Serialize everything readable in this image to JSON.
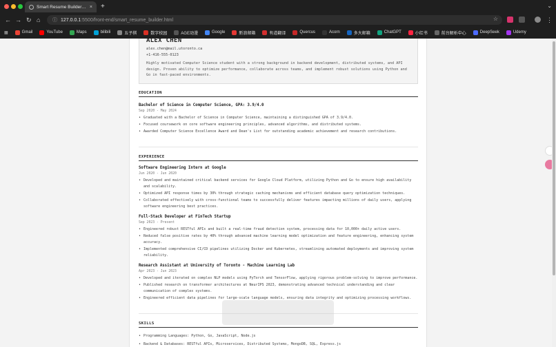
{
  "browser": {
    "tab_title": "Smart Resume Builder - Ideas",
    "url_host": "127.0.0.1",
    "url_path": ":5500/front-end/smart_resume_builder.html",
    "bookmarks": [
      "Gmail",
      "YouTube",
      "Maps",
      "bilibili",
      "五子棋",
      "数字校园",
      "AGE动漫",
      "Google",
      "新浪邮箱",
      "有道翻译",
      "Quercus",
      "Acorn",
      "多大邮箱",
      "ChatGPT",
      "小红书",
      "前台解析中心",
      "DeepSeek",
      "Udemy"
    ],
    "bookmark_colors": [
      "#ea4335",
      "#ff0000",
      "#34a853",
      "#00a1d6",
      "#888888",
      "#d93025",
      "#555555",
      "#4285f4",
      "#e53935",
      "#d32f2f",
      "#c62828",
      "#333333",
      "#1565c0",
      "#10a37f",
      "#ff2442",
      "#666666",
      "#4d6bfe",
      "#a435f0"
    ]
  },
  "resume": {
    "name": "ALEX CHEN",
    "email": "alex.chen@mail.utoronto.ca",
    "phone": "+1-416-555-0123",
    "summary": "Highly motivated Computer Science student with a strong background in backend development, distributed systems, and API design. Proven ability to optimize performance, collaborate across teams, and implement robust solutions using Python and Go in fast-paced environments.",
    "education": {
      "title": "EDUCATION",
      "degree": "Bachelor of Science in Computer Science, GPA: 3.9/4.0",
      "date": "Sep 2020 - May 2024",
      "bullets": [
        "Graduated with a Bachelor of Science in Computer Science, maintaining a distinguished GPA of 3.9/4.0.",
        "Focused coursework on core software engineering principles, advanced algorithms, and distributed systems.",
        "Awarded Computer Science Excellence Award and Dean's List for outstanding academic achievement and research contributions."
      ]
    },
    "experience": {
      "title": "EXPERIENCE",
      "jobs": [
        {
          "title": "Software Engineering Intern at Google",
          "date": "Jun 2020 - Jun 2020",
          "bullets": [
            "Developed and maintained critical backend services for Google Cloud Platform, utilizing Python and Go to ensure high availability and scalability.",
            "Optimized API response times by 30% through strategic caching mechanisms and efficient database query optimization techniques.",
            "Collaborated effectively with cross-functional teams to successfully deliver features impacting millions of daily users, applying software engineering best practices."
          ]
        },
        {
          "title": "Full-Stack Developer at FinTech Startup",
          "date": "Sep 2023 - Present",
          "bullets": [
            "Engineered robust RESTful APIs and built a real-time fraud detection system, processing data for 10,000+ daily active users.",
            "Reduced false positive rates by 40% through advanced machine learning model optimization and feature engineering, enhancing system accuracy.",
            "Implemented comprehensive CI/CD pipelines utilizing Docker and Kubernetes, streamlining automated deployments and improving system reliability."
          ]
        },
        {
          "title": "Research Assistant at University of Toronto - Machine Learning Lab",
          "date": "Apr 2023 - Jun 2023",
          "bullets": [
            "Developed and iterated on complex NLP models using PyTorch and TensorFlow, applying rigorous problem-solving to improve performance.",
            "Published research on transformer architectures at NeurIPS 2023, demonstrating advanced technical understanding and clear communication of complex systems.",
            "Engineered efficient data pipelines for large-scale language models, ensuring data integrity and optimizing processing workflows."
          ]
        }
      ]
    },
    "skills": {
      "title": "SKILLS",
      "bullets": [
        "Programming Languages: Python, Go, JavaScript, Node.js",
        "Backend & Databases: RESTful APIs, Microservices, Distributed Systems, MongoDB, SQL, Express.js"
      ]
    }
  }
}
